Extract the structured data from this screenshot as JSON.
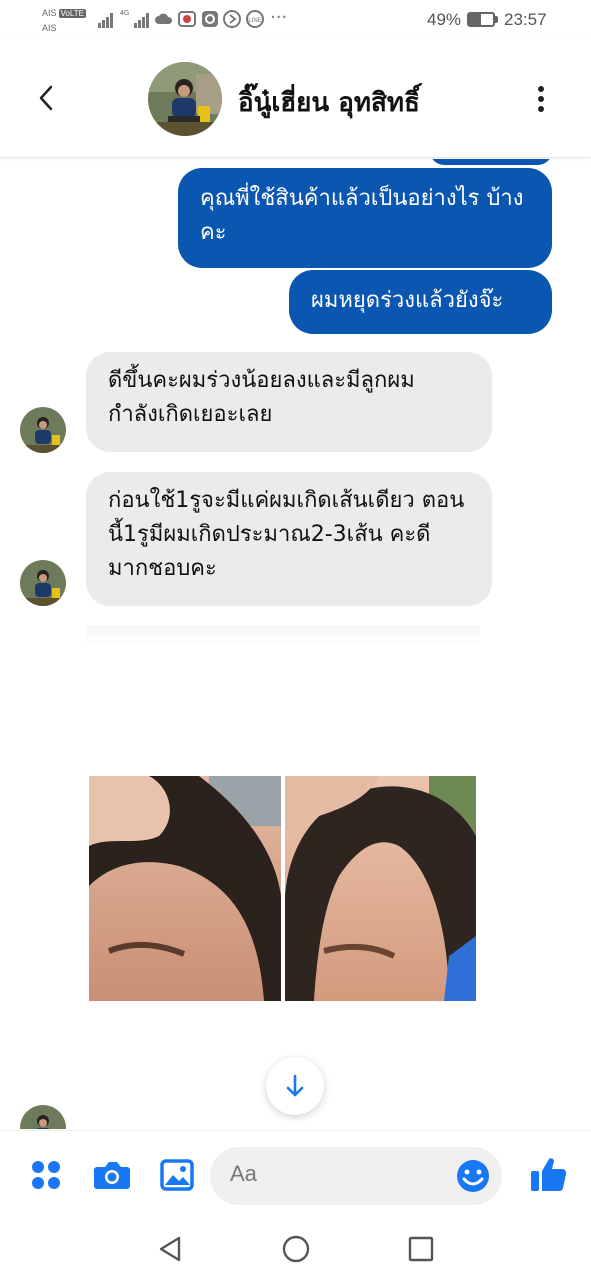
{
  "status_bar": {
    "carrier_top": "AIS",
    "volte": "VoLTE",
    "carrier_bottom": "AIS",
    "network": "4G",
    "battery_percent": "49%",
    "battery_level": 0.49,
    "time": "23:57",
    "icons": [
      "signal-icon",
      "signal-4g-icon",
      "cloud-icon",
      "app-notification-icon",
      "instagram-icon",
      "vpn-icon",
      "line-icon",
      "more-dots-icon"
    ]
  },
  "header": {
    "contact_name": "อิ๊นู๋เฮี่ยน อุทสิทธิ์",
    "back_icon": "back-arrow-icon",
    "menu_icon": "more-vertical-icon"
  },
  "messages": [
    {
      "direction": "outgoing",
      "text": "คุณพี่ใช้สินค้าแล้วเป็นอย่างไร บ้างคะ"
    },
    {
      "direction": "outgoing",
      "text": "ผมหยุดร่วงแล้วยังจ๊ะ"
    },
    {
      "direction": "incoming",
      "text": "ดีขึ้นคะผมร่วงน้อยลงและมีลูกผม กำลังเกิดเยอะเลย"
    },
    {
      "direction": "incoming",
      "text": "ก่อนใช้1รูจะมีแค่ผมเกิดเส้นเดียว ตอนนี้1รูมีผมเกิดประมาณ2-3เส้น คะดีมากชอบคะ"
    },
    {
      "direction": "incoming",
      "type": "photo",
      "caption": ""
    }
  ],
  "composer": {
    "placeholder": "Aa",
    "icons": [
      "apps-grid-icon",
      "camera-icon",
      "gallery-icon",
      "emoji-icon",
      "thumbs-up-icon"
    ]
  },
  "colors": {
    "accent": "#1877f2",
    "outgoing_bubble": "#0b56b0",
    "incoming_bubble": "#ebebeb"
  }
}
